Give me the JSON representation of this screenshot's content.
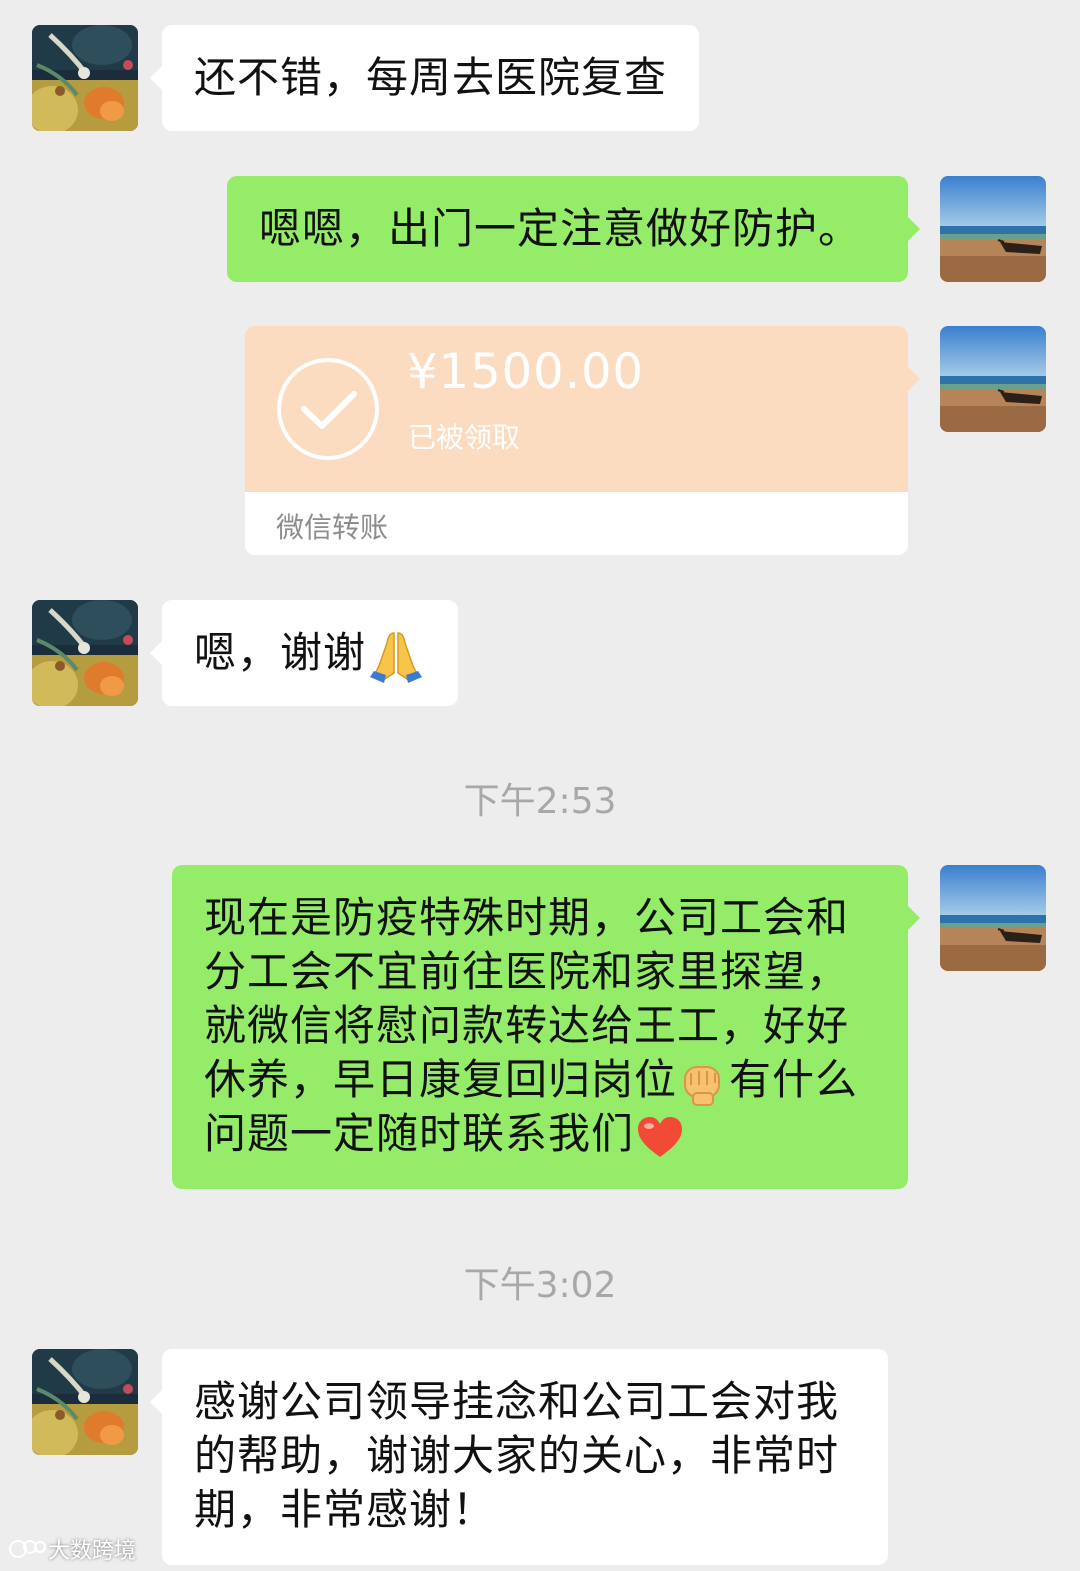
{
  "chat": {
    "messages": [
      {
        "side": "left",
        "text": "还不错，每周去医院复查"
      },
      {
        "side": "right",
        "text": "嗯嗯，出门一定注意做好防护。"
      },
      {
        "side": "right",
        "type": "transfer",
        "amount": "¥1500.00",
        "status": "已被领取",
        "label": "微信转账"
      },
      {
        "side": "left",
        "text": "嗯，谢谢",
        "emoji": "folded-hands"
      },
      {
        "side": "right",
        "lines": [
          "现在是防疫特殊时期，公司工会和",
          "分工会不宜前往医院和家里探望，",
          "就微信将慰问款转达给王工，好好",
          "休养，早日康复回归岗位",
          "问题一定随时联系我们"
        ],
        "line4_suffix": "有什么"
      },
      {
        "side": "left",
        "lines": [
          "感谢公司领导挂念和公司工会对我",
          "的帮助，谢谢大家的关心，非常时",
          "期，非常感谢！"
        ]
      }
    ],
    "timestamps": [
      "下午2:53",
      "下午3:02"
    ]
  },
  "watermark": {
    "text": "大数跨境"
  },
  "colors": {
    "background": "#ededed",
    "bubble_self": "#95ec69",
    "bubble_other": "#ffffff",
    "transfer_received": "#fbdcc1",
    "timestamp_text": "#a8a8a8"
  }
}
